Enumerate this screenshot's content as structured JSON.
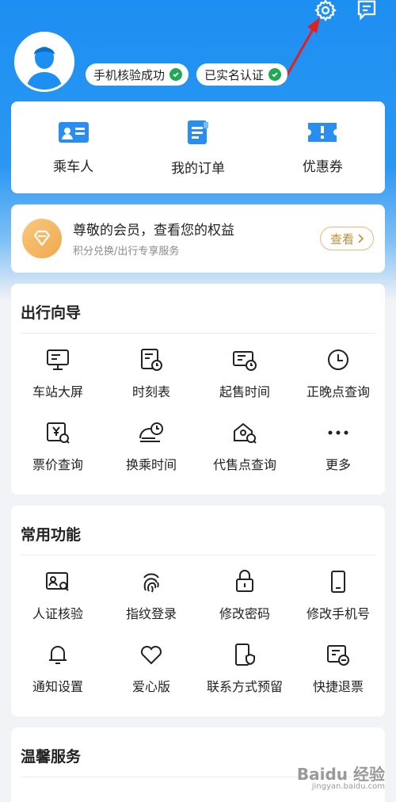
{
  "header": {
    "top_icons": [
      "settings-icon",
      "message-icon"
    ],
    "badges": [
      {
        "label": "手机核验成功"
      },
      {
        "label": "已实名认证"
      }
    ]
  },
  "quick_actions": [
    {
      "label": "乘车人",
      "icon": "passenger-icon"
    },
    {
      "label": "我的订单",
      "icon": "order-icon"
    },
    {
      "label": "优惠券",
      "icon": "coupon-icon"
    }
  ],
  "member": {
    "title": "尊敬的会员，查看您的权益",
    "subtitle": "积分兑换/出行专享服务",
    "view_label": "查看"
  },
  "travel_guide": {
    "title": "出行向导",
    "items": [
      {
        "label": "车站大屏",
        "icon": "station-screen-icon"
      },
      {
        "label": "时刻表",
        "icon": "timetable-icon"
      },
      {
        "label": "起售时间",
        "icon": "sale-time-icon"
      },
      {
        "label": "正晚点查询",
        "icon": "clock-icon"
      },
      {
        "label": "票价查询",
        "icon": "fare-search-icon"
      },
      {
        "label": "换乘时间",
        "icon": "transfer-time-icon"
      },
      {
        "label": "代售点查询",
        "icon": "agency-search-icon"
      },
      {
        "label": "更多",
        "icon": "more-icon"
      }
    ]
  },
  "common_functions": {
    "title": "常用功能",
    "items": [
      {
        "label": "人证核验",
        "icon": "id-verify-icon"
      },
      {
        "label": "指纹登录",
        "icon": "fingerprint-icon"
      },
      {
        "label": "修改密码",
        "icon": "lock-icon"
      },
      {
        "label": "修改手机号",
        "icon": "phone-icon"
      },
      {
        "label": "通知设置",
        "icon": "bell-icon"
      },
      {
        "label": "爱心版",
        "icon": "heart-icon"
      },
      {
        "label": "联系方式预留",
        "icon": "contact-shield-icon"
      },
      {
        "label": "快捷退票",
        "icon": "refund-ticket-icon"
      }
    ]
  },
  "warm_service": {
    "title": "温馨服务"
  },
  "watermark": {
    "text": "Baidu 经验",
    "sub": "jingyan.baidu.com"
  },
  "colors": {
    "primary_blue": "#1d8ff2",
    "verified_green": "#22a754",
    "annotation_red": "#e02020",
    "member_gold": "#f0a84b"
  }
}
